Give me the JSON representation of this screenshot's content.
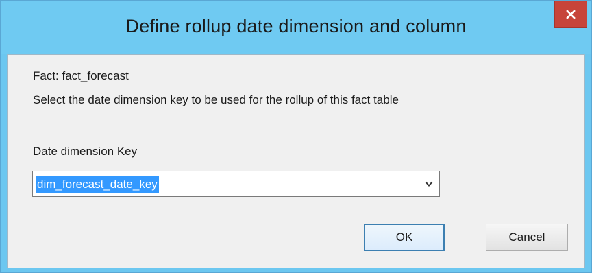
{
  "dialog": {
    "title": "Define rollup date dimension and column",
    "close_label": "×"
  },
  "content": {
    "fact_label": "Fact: fact_forecast",
    "instruction": "Select the date dimension key to be used for the rollup of this fact table",
    "date_key_label": "Date dimension Key",
    "date_key_value": "dim_forecast_date_key"
  },
  "buttons": {
    "ok": "OK",
    "cancel": "Cancel"
  },
  "colors": {
    "titlebar": "#6fcaf2",
    "close_button": "#c7443a",
    "selection": "#3399ff",
    "client_bg": "#f0f0f0"
  },
  "icons": {
    "close": "close-icon",
    "dropdown": "chevron-down-icon"
  }
}
